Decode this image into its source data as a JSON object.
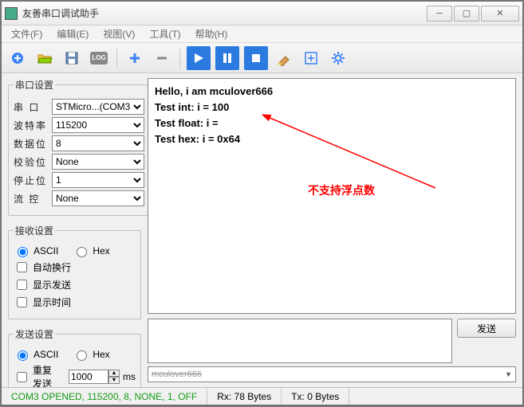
{
  "window": {
    "title": "友善串口调试助手"
  },
  "menu": {
    "file": "文件(F)",
    "edit": "编辑(E)",
    "view": "视图(V)",
    "tools": "工具(T)",
    "help": "帮助(H)"
  },
  "toolbar_icons": {
    "new": "new-icon",
    "open": "open-icon",
    "save": "save-icon",
    "log": "LOG",
    "plus": "plus-icon",
    "minus": "minus-icon",
    "play": "play-icon",
    "pause": "pause-icon",
    "stop": "stop-icon",
    "clear": "clear-icon",
    "expand": "expand-icon",
    "settings": "gear-icon"
  },
  "port_settings": {
    "legend": "串口设置",
    "labels": {
      "port": "串  口",
      "baud": "波特率",
      "data": "数据位",
      "parity": "校验位",
      "stop": "停止位",
      "flow": "流  控"
    },
    "values": {
      "port": "STMicro...(COM3",
      "baud": "115200",
      "data": "8",
      "parity": "None",
      "stop": "1",
      "flow": "None"
    }
  },
  "recv_settings": {
    "legend": "接收设置",
    "ascii": "ASCII",
    "hex": "Hex",
    "autowrap": "自动换行",
    "showsend": "显示发送",
    "showtime": "显示时间",
    "ascii_checked": true,
    "hex_checked": false,
    "autowrap_checked": false,
    "showsend_checked": false,
    "showtime_checked": false
  },
  "send_settings": {
    "legend": "发送设置",
    "ascii": "ASCII",
    "hex": "Hex",
    "ascii_checked": true,
    "hex_checked": false,
    "repeat": "重复发送",
    "repeat_checked": false,
    "interval": "1000",
    "unit": "ms"
  },
  "rx": {
    "l1": "Hello, i am mculover666",
    "l2": "Test int: i = 100",
    "l3": "Test float: i = ",
    "l4": "Test hex: i = 0x64"
  },
  "annotation": "不支持浮点数",
  "send_button": "发送",
  "history_placeholder": "mculover666",
  "status": {
    "conn": "COM3 OPENED, 115200, 8, NONE, 1, OFF",
    "rx": "Rx: 78 Bytes",
    "tx": "Tx: 0 Bytes"
  }
}
